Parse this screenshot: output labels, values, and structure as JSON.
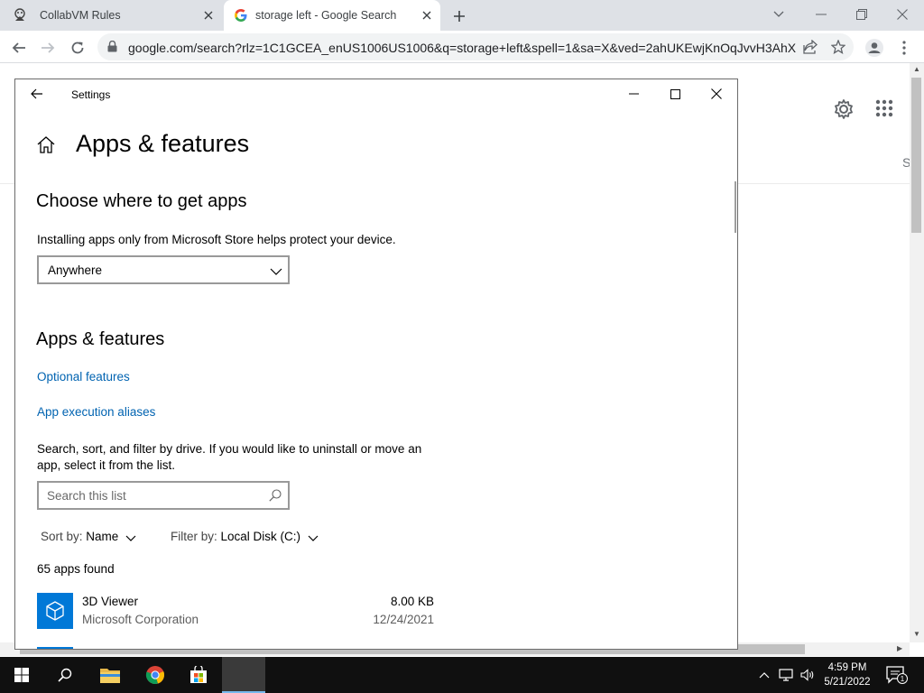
{
  "browser": {
    "tabs": [
      {
        "title": "CollabVM Rules"
      },
      {
        "title": "storage left - Google Search"
      }
    ],
    "url": "google.com/search?rlz=1C1GCEA_enUS1006US1006&q=storage+left&spell=1&sa=X&ved=2ahUKEwjKnOqJvvH3AhX..."
  },
  "google": {
    "partial_tab_letter": "S"
  },
  "settings": {
    "window_title": "Settings",
    "page_title": "Apps & features",
    "choose_heading": "Choose where to get apps",
    "choose_desc": "Installing apps only from Microsoft Store helps protect your device.",
    "source_selected": "Anywhere",
    "section_heading": "Apps & features",
    "link_optional": "Optional features",
    "link_aliases": "App execution aliases",
    "search_desc_1": "Search, sort, and filter by drive. If you would like to uninstall or move an",
    "search_desc_2": "app, select it from the list.",
    "search_placeholder": "Search this list",
    "sort_label": "Sort by:",
    "sort_value": "Name",
    "filter_label": "Filter by:",
    "filter_value": "Local Disk (C:)",
    "apps_count": "65 apps found",
    "apps": [
      {
        "name": "3D Viewer",
        "publisher": "Microsoft Corporation",
        "size": "8.00 KB",
        "date": "12/24/2021"
      }
    ]
  },
  "taskbar": {
    "time": "4:59 PM",
    "date": "5/21/2022",
    "notification_count": "1"
  },
  "colors": {
    "accent": "#0078d7",
    "link": "#0063b1",
    "taskbar": "#101010"
  }
}
